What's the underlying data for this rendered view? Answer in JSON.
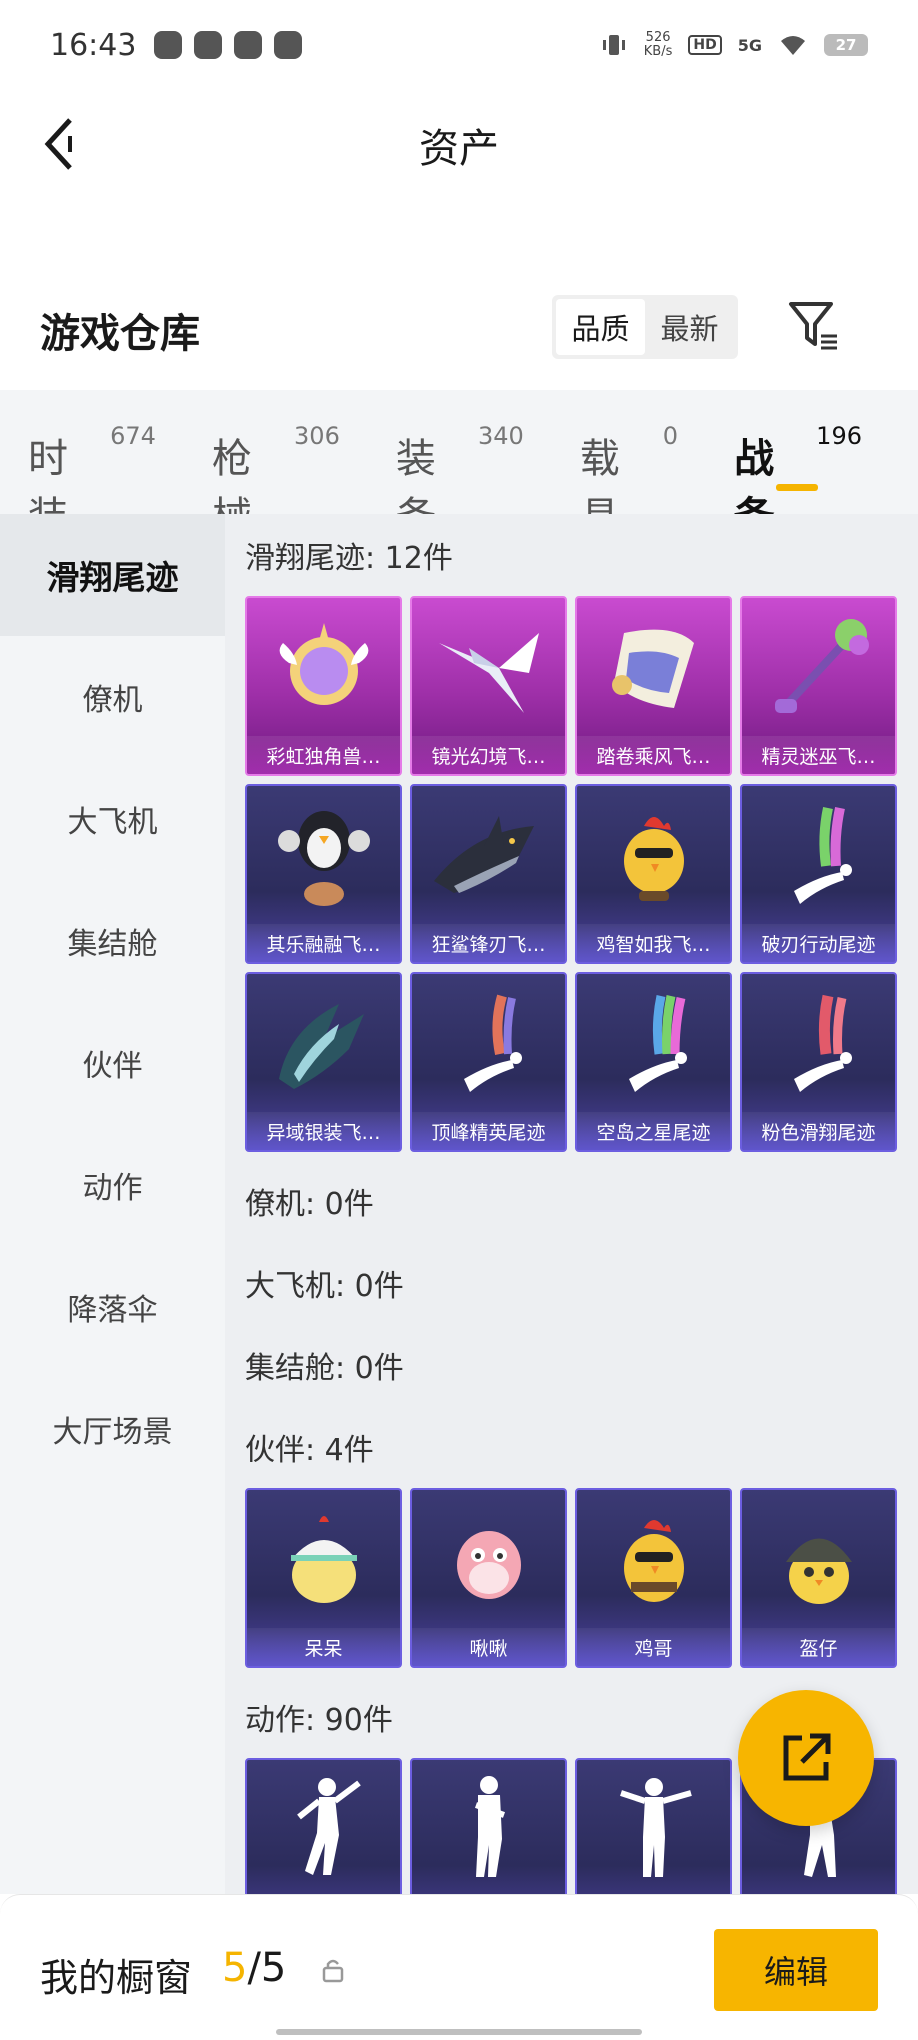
{
  "status_bar": {
    "time": "16:43",
    "speed_value": "526",
    "speed_unit": "KB/s",
    "hd": "HD",
    "network": "5G",
    "battery": "27"
  },
  "header": {
    "title": "资产"
  },
  "warehouse": {
    "title": "游戏仓库",
    "sort_options": [
      "品质",
      "最新"
    ],
    "active_sort": "品质"
  },
  "category_tabs": [
    {
      "label": "时装",
      "count": "674"
    },
    {
      "label": "枪械",
      "count": "306"
    },
    {
      "label": "装备",
      "count": "340"
    },
    {
      "label": "载具",
      "count": "0"
    },
    {
      "label": "战备",
      "count": "196",
      "active": true
    }
  ],
  "sidebar": {
    "items": [
      "滑翔尾迹",
      "僚机",
      "大飞机",
      "集结舱",
      "伙伴",
      "动作",
      "降落伞",
      "大厅场景"
    ],
    "active": "滑翔尾迹"
  },
  "sections": [
    {
      "title": "滑翔尾迹: 12件",
      "items": [
        {
          "label": "彩虹独角兽…",
          "rarity": "purple",
          "icon": "unicorn-emblem-icon"
        },
        {
          "label": "镜光幻境飞…",
          "rarity": "purple",
          "icon": "crystal-wing-icon"
        },
        {
          "label": "踏卷乘风飞…",
          "rarity": "purple",
          "icon": "scroll-icon"
        },
        {
          "label": "精灵迷巫飞…",
          "rarity": "purple",
          "icon": "broom-icon"
        },
        {
          "label": "其乐融融飞…",
          "rarity": "blue",
          "icon": "penguin-balloon-icon"
        },
        {
          "label": "狂鲨锋刃飞…",
          "rarity": "blue",
          "icon": "shark-icon"
        },
        {
          "label": "鸡智如我飞…",
          "rarity": "blue",
          "icon": "chicken-icon"
        },
        {
          "label": "破刃行动尾迹",
          "rarity": "blue",
          "icon": "smoke-trail-icon"
        },
        {
          "label": "异域银装飞…",
          "rarity": "blue",
          "icon": "silver-wing-icon"
        },
        {
          "label": "顶峰精英尾迹",
          "rarity": "blue",
          "icon": "smoke-trail-icon"
        },
        {
          "label": "空岛之星尾迹",
          "rarity": "blue",
          "icon": "smoke-trail-icon"
        },
        {
          "label": "粉色滑翔尾迹",
          "rarity": "blue",
          "icon": "smoke-trail-icon"
        }
      ]
    },
    {
      "title": "僚机: 0件",
      "items": []
    },
    {
      "title": "大飞机: 0件",
      "items": []
    },
    {
      "title": "集结舱: 0件",
      "items": []
    },
    {
      "title": "伙伴: 4件",
      "items": [
        {
          "label": "呆呆",
          "rarity": "blue",
          "icon": "chick-egg-icon"
        },
        {
          "label": "啾啾",
          "rarity": "blue",
          "icon": "pink-bird-icon"
        },
        {
          "label": "鸡哥",
          "rarity": "blue",
          "icon": "chicken-sunglasses-icon"
        },
        {
          "label": "盔仔",
          "rarity": "blue",
          "icon": "chick-helmet-icon"
        }
      ]
    },
    {
      "title": "动作: 90件",
      "items": [
        {
          "label": "",
          "rarity": "blue",
          "icon": "dance-pose-icon"
        },
        {
          "label": "",
          "rarity": "blue",
          "icon": "dance-pose-icon"
        },
        {
          "label": "",
          "rarity": "blue",
          "icon": "dance-pose-icon"
        },
        {
          "label": "",
          "rarity": "blue",
          "icon": "dance-pose-icon"
        }
      ]
    }
  ],
  "bottom_bar": {
    "label": "我的橱窗",
    "current": "5",
    "total": "/5",
    "edit": "编辑"
  },
  "colors": {
    "accent": "#f7b500",
    "purple_rarity": "#c94bd0",
    "blue_rarity": "#3b3a74"
  }
}
